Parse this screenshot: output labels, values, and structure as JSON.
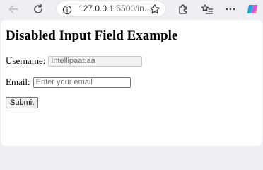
{
  "browser": {
    "url_host": "127.0.0.1",
    "url_rest": ":5500/in...",
    "icons": {
      "back": "back-arrow-icon",
      "reload": "reload-icon",
      "site_info": "info-icon",
      "favorite": "star-icon",
      "extensions": "extensions-icon",
      "favorites_list": "favorites-icon",
      "more": "more-icon",
      "copilot": "copilot-icon"
    }
  },
  "page": {
    "title": "Disabled Input Field Example",
    "username": {
      "label": "Username:",
      "value": "Intellipaat.aa",
      "disabled": true
    },
    "email": {
      "label": "Email:",
      "value": "",
      "placeholder": "Enter your email"
    },
    "submit_label": "Submit"
  },
  "colors": {
    "chrome_background": "#efeff3",
    "content_background": "#ffffff"
  }
}
